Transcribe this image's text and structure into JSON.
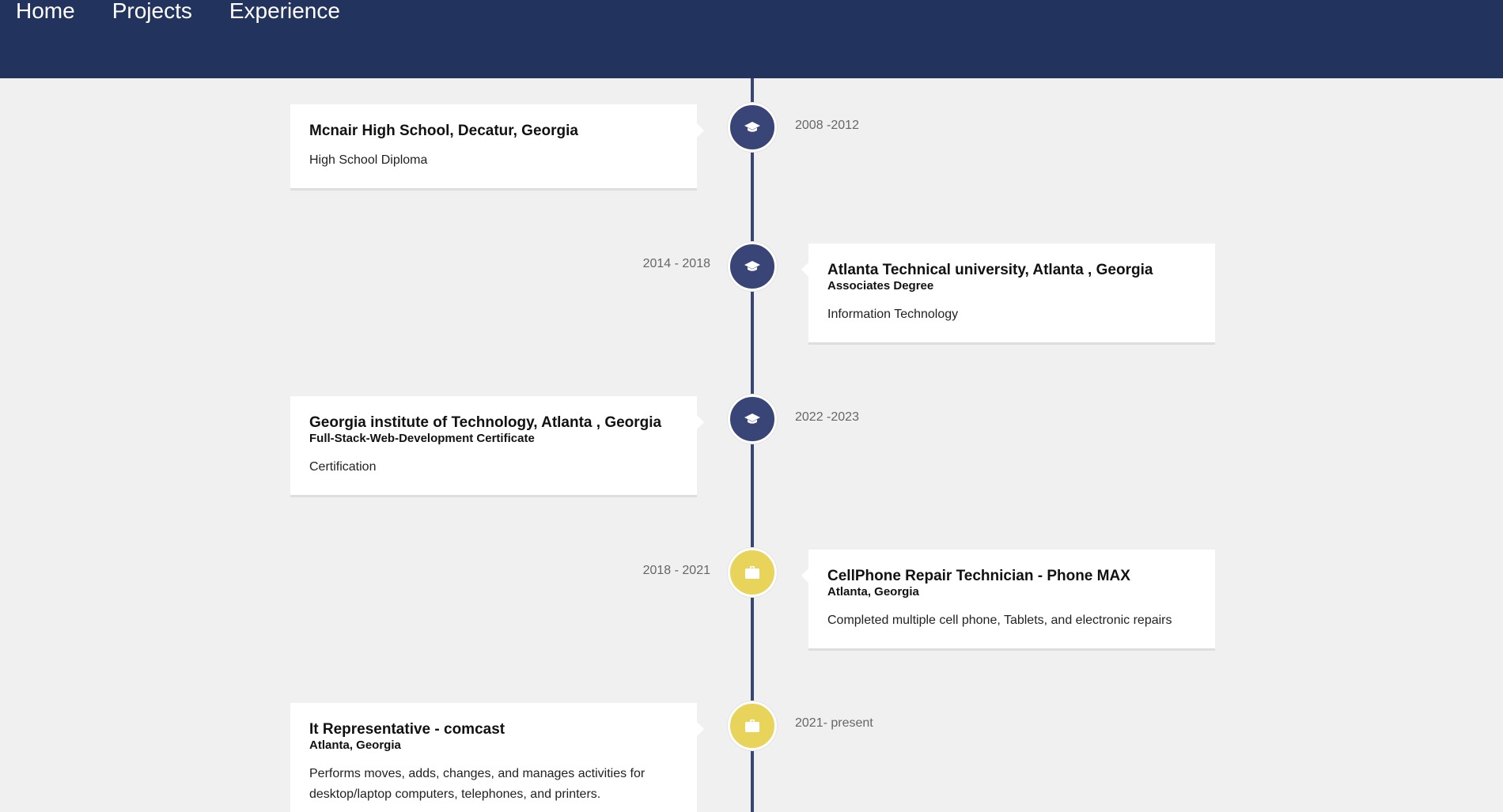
{
  "nav": {
    "home": "Home",
    "projects": "Projects",
    "experience": "Experience"
  },
  "colors": {
    "header": "#22335e",
    "education_icon": "#3a4577",
    "work_icon": "#e8d45b",
    "timeline_line": "#3a4577",
    "background": "#f0f0f0"
  },
  "timeline": [
    {
      "type": "education",
      "icon": "graduation-cap-icon",
      "title": "Mcnair High School, Decatur, Georgia",
      "subtitle": "",
      "description": "High School Diploma",
      "date": "2008 -2012"
    },
    {
      "type": "education",
      "icon": "graduation-cap-icon",
      "title": "Atlanta Technical university, Atlanta , Georgia",
      "subtitle": "Associates Degree",
      "description": "Information Technology",
      "date": "2014 - 2018"
    },
    {
      "type": "education",
      "icon": "graduation-cap-icon",
      "title": "Georgia institute of Technology, Atlanta , Georgia",
      "subtitle": "Full-Stack-Web-Development Certificate",
      "description": "Certification",
      "date": "2022 -2023"
    },
    {
      "type": "work",
      "icon": "briefcase-icon",
      "title": "CellPhone Repair Technician - Phone MAX",
      "subtitle": "Atlanta, Georgia",
      "description": "Completed multiple cell phone, Tablets, and electronic repairs",
      "date": "2018 - 2021"
    },
    {
      "type": "work",
      "icon": "briefcase-icon",
      "title": "It Representative - comcast",
      "subtitle": "Atlanta, Georgia",
      "description": "Performs moves, adds, changes, and manages activities for desktop/laptop computers, telephones, and printers.",
      "date": "2021- present"
    }
  ]
}
